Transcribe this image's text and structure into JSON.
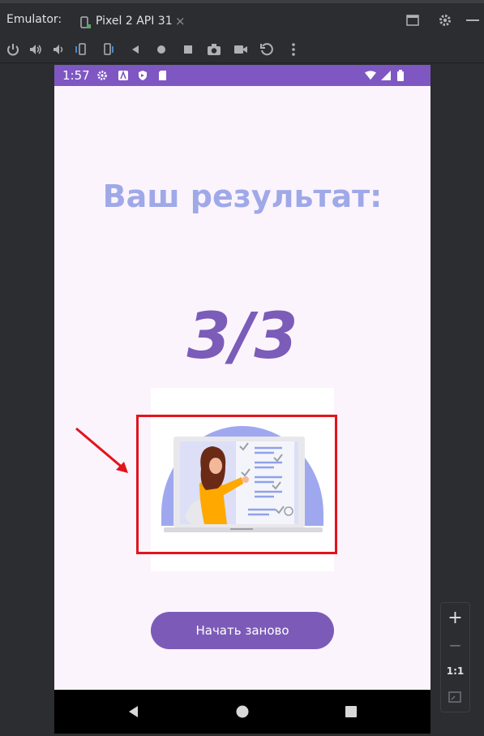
{
  "toolbar_title": "Emulator:",
  "tab": {
    "label": "Pixel 2 API 31",
    "close": "×"
  },
  "statusbar": {
    "time": "1:57"
  },
  "screen": {
    "title": "Ваш результат:",
    "score": "3/3",
    "restart_button": "Начать заново"
  },
  "zoom": {
    "plus": "+",
    "minus": "−",
    "one_to_one": "1:1"
  },
  "colors": {
    "accent_purple": "#7e57c2",
    "title_lavender": "#9fa9e8",
    "annotation_red": "#e2141c",
    "figure_orange": "#ffa800"
  }
}
